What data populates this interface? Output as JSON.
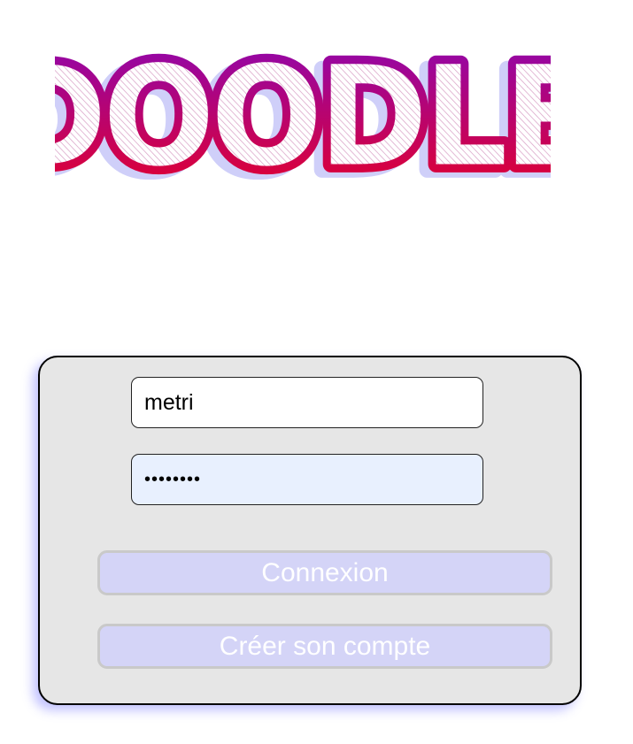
{
  "logo": {
    "text": "DOODLE",
    "colors": {
      "gradient_top": "#8e07b0",
      "gradient_bottom": "#e4002b",
      "shadow": "#c8c8f8",
      "fill": "#ffffff"
    }
  },
  "login_form": {
    "username_value": "metri",
    "password_value": "metripwd",
    "login_button_label": "Connexion",
    "register_button_label": "Créer son compte"
  },
  "colors": {
    "card_background": "#e6e6e6",
    "button_background": "#d4d4f7",
    "button_text": "#ffffff",
    "password_autofill": "#e8f0fe"
  }
}
